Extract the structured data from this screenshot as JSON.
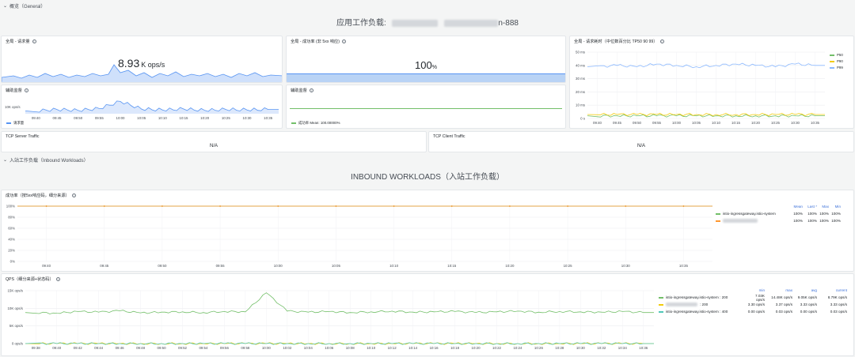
{
  "rows": {
    "general": "概览（General）",
    "inbound": "入站工作负载（Inbound Workloads）"
  },
  "banners": {
    "app_title_prefix": "应用工作负载:",
    "app_title_suffix": "n-888",
    "inbound_title": "INBOUND WORKLOADS（入站工作负载）"
  },
  "panels": {
    "requests": {
      "title": "全局 - 请求量",
      "value": "8.93",
      "unit": "K ops/s"
    },
    "success": {
      "title": "全局 - 成功率 (非 5xx 响应)",
      "value": "100",
      "unit": "%"
    },
    "latency": {
      "title": "全局 - 请求耗时（中位数百分比 TP50 90 99）"
    },
    "aux1": {
      "title": "辅助监督",
      "legend": "请求量",
      "ytick": "10K ops/s"
    },
    "aux2": {
      "title": "辅助监督",
      "legend": "成功率  Mean: 100.00000%"
    },
    "tcp_server": {
      "title": "TCP Server Traffic",
      "value": "N/A"
    },
    "tcp_client": {
      "title": "TCP Client Traffic",
      "value": "N/A"
    },
    "inbound_success": {
      "title": "成功率（按5xx响应码，细分来源）"
    },
    "qps": {
      "title": "QPS（细分来源+状态码）"
    }
  },
  "colors": {
    "blue": "#5794f2",
    "green": "#73bf69",
    "yellow": "#f2cc0c",
    "orange": "#ff9830",
    "lightblue": "#8ab8ff",
    "teal": "#4fc7b8"
  },
  "chart_data": [
    {
      "type": "area",
      "title": "全局 - 请求量",
      "x": [
        "09:40",
        "09:45",
        "09:50",
        "09:55",
        "10:00",
        "10:05",
        "10:10",
        "10:15",
        "10:20",
        "10:25",
        "10:30",
        "10:35"
      ],
      "series": [
        {
          "name": "请求量",
          "values": [
            8.6,
            8.9,
            8.7,
            9.1,
            10.6,
            9.0,
            8.8,
            9.0,
            8.7,
            8.9,
            8.8,
            8.9
          ]
        }
      ],
      "ytick": "10K ops/s"
    },
    {
      "type": "line",
      "title": "全局 - 请求耗时（中位数百分比 TP50 90 99）",
      "x": [
        "09:40",
        "09:45",
        "09:50",
        "09:55",
        "10:00",
        "10:05",
        "10:10",
        "10:15",
        "10:20",
        "10:25",
        "10:30",
        "10:35"
      ],
      "yticks": [
        "50 ms",
        "40 ms",
        "30 ms",
        "20 ms",
        "10 ms",
        "0 s"
      ],
      "ylim": [
        0,
        50
      ],
      "series": [
        {
          "name": "P50",
          "values": [
            2,
            2,
            2,
            2,
            2,
            2,
            2,
            2,
            2,
            2,
            2,
            2
          ]
        },
        {
          "name": "P90",
          "values": [
            3,
            3,
            3,
            3,
            3,
            3,
            3,
            3,
            3,
            3,
            3,
            3
          ]
        },
        {
          "name": "P99",
          "values": [
            39,
            40,
            39,
            41,
            40,
            39,
            40,
            41,
            40,
            39,
            41,
            40
          ]
        }
      ]
    },
    {
      "type": "line",
      "title": "成功率（按5xx响应码，细分来源）",
      "x": [
        "09:40",
        "09:45",
        "09:50",
        "09:55",
        "10:00",
        "10:05",
        "10:10",
        "10:15",
        "10:20",
        "10:25",
        "10:30",
        "10:35"
      ],
      "yticks": [
        "100%",
        "80%",
        "60%",
        "40%",
        "20%",
        "0%"
      ],
      "ylim": [
        0,
        100
      ],
      "legend_headers": [
        "Mean",
        "Last *",
        "Max",
        "Min"
      ],
      "series": [
        {
          "name": "istio-ingressgateway.istio-system",
          "values": [
            100,
            100,
            100,
            100,
            100,
            100,
            100,
            100,
            100,
            100,
            100,
            100
          ],
          "stats": [
            "100%",
            "100%",
            "100%",
            "100%"
          ]
        },
        {
          "name": "",
          "values": [
            100,
            100,
            100,
            100,
            100,
            100,
            100,
            100,
            100,
            100,
            100,
            100
          ],
          "stats": [
            "100%",
            "100%",
            "100%",
            "100%"
          ]
        }
      ]
    },
    {
      "type": "line",
      "title": "QPS（细分来源+状态码）",
      "x": [
        "09:38",
        "09:40",
        "09:42",
        "09:44",
        "09:46",
        "09:48",
        "09:50",
        "09:52",
        "09:54",
        "09:56",
        "09:58",
        "10:00",
        "10:02",
        "10:04",
        "10:06",
        "10:08",
        "10:10",
        "10:12",
        "10:14",
        "10:16",
        "10:18",
        "10:20",
        "10:22",
        "10:24",
        "10:26",
        "10:28",
        "10:30",
        "10:32",
        "10:34",
        "10:36"
      ],
      "yticks": [
        "15K ops/s",
        "10K ops/s",
        "5K ops/s",
        "0 ops/s"
      ],
      "ylim": [
        0,
        15000
      ],
      "legend_headers": [
        "min",
        "max",
        "avg",
        "current"
      ],
      "series": [
        {
          "name": "istio-ingressgateway.istio-system : 200",
          "values": [
            8800,
            8600,
            9100,
            8900,
            9300,
            8700,
            8900,
            9000,
            8800,
            9100,
            9000,
            14400,
            9200,
            8900,
            9100,
            8800,
            9000,
            9200,
            8900,
            9000,
            9100,
            8800,
            9000,
            9200,
            8900,
            9100,
            9000,
            8900,
            9100,
            8790
          ],
          "stats": [
            "7.03K ops/s",
            "14.48K ops/s",
            "9.05K ops/s",
            "8.79K ops/s"
          ]
        },
        {
          "name": ": 200",
          "values": [
            3,
            3,
            3,
            3,
            3,
            3,
            3,
            3,
            3,
            3,
            3,
            3,
            3,
            3,
            3,
            3,
            3,
            3,
            3,
            3,
            3,
            3,
            3,
            3,
            3,
            3,
            3,
            3,
            3,
            3
          ],
          "stats": [
            "3.30 ops/s",
            "3.37 ops/s",
            "3.33 ops/s",
            "3.33 ops/s"
          ]
        },
        {
          "name": "istio-ingressgateway.istio-system : 400",
          "values": [
            0,
            0,
            0,
            0,
            0,
            0,
            0,
            0,
            0,
            0,
            0,
            0,
            0,
            0,
            0,
            0,
            0,
            0,
            0,
            0,
            0,
            0,
            0,
            0,
            0,
            0,
            0,
            0,
            0,
            0
          ],
          "stats": [
            "0.00 ops/s",
            "0.03 ops/s",
            "0.00 ops/s",
            "0.03 ops/s"
          ]
        }
      ]
    }
  ]
}
